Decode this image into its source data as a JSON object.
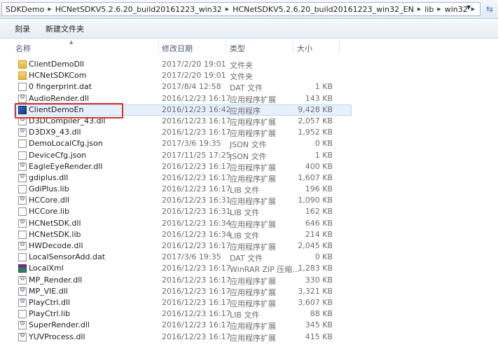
{
  "address_bar": {
    "crumbs": [
      "SDKDemo",
      "HCNetSDKV5.2.6.20_build20161223_win32",
      "HCNetSDKV5.2.6.20_build20161223_win32_EN",
      "lib",
      "win32"
    ]
  },
  "toolbar": {
    "burn_label": "刻录",
    "new_folder_label": "新建文件夹"
  },
  "columns": {
    "name": "名称",
    "modified": "修改日期",
    "type": "类型",
    "size": "大小"
  },
  "files": [
    {
      "name": "ClientDemoDll",
      "date": "2017/2/20 19:01",
      "type": "文件夹",
      "size": "",
      "icon": "folder-icon"
    },
    {
      "name": "HCNetSDKCom",
      "date": "2017/2/20 19:01",
      "type": "文件夹",
      "size": "",
      "icon": "folder-icon"
    },
    {
      "name": "0 fingerprint.dat",
      "date": "2017/8/4 12:58",
      "type": "DAT 文件",
      "size": "1 KB",
      "icon": "file-icon"
    },
    {
      "name": "AudioRender.dll",
      "date": "2016/12/23 16:17",
      "type": "应用程序扩展",
      "size": "143 KB",
      "icon": "dll-icon"
    },
    {
      "name": "ClientDemoEn",
      "date": "2016/12/23 16:42",
      "type": "应用程序",
      "size": "9,428 KB",
      "icon": "exe-icon"
    },
    {
      "name": "D3DCompiler_43.dll",
      "date": "2016/12/23 16:17",
      "type": "应用程序扩展",
      "size": "2,057 KB",
      "icon": "dll-icon"
    },
    {
      "name": "D3DX9_43.dll",
      "date": "2016/12/23 16:17",
      "type": "应用程序扩展",
      "size": "1,952 KB",
      "icon": "dll-icon"
    },
    {
      "name": "DemoLocalCfg.json",
      "date": "2017/3/6 19:35",
      "type": "JSON 文件",
      "size": "0 KB",
      "icon": "file-icon"
    },
    {
      "name": "DeviceCfg.json",
      "date": "2017/11/25 17:25",
      "type": "JSON 文件",
      "size": "1 KB",
      "icon": "file-icon"
    },
    {
      "name": "EagleEyeRender.dll",
      "date": "2016/12/23 16:17",
      "type": "应用程序扩展",
      "size": "400 KB",
      "icon": "dll-icon"
    },
    {
      "name": "gdiplus.dll",
      "date": "2016/12/23 16:17",
      "type": "应用程序扩展",
      "size": "1,607 KB",
      "icon": "dll-icon"
    },
    {
      "name": "GdiPlus.lib",
      "date": "2016/12/23 16:17",
      "type": "LIB 文件",
      "size": "196 KB",
      "icon": "file-icon"
    },
    {
      "name": "HCCore.dll",
      "date": "2016/12/23 16:31",
      "type": "应用程序扩展",
      "size": "1,090 KB",
      "icon": "dll-icon"
    },
    {
      "name": "HCCore.lib",
      "date": "2016/12/23 16:31",
      "type": "LIB 文件",
      "size": "162 KB",
      "icon": "file-icon"
    },
    {
      "name": "HCNetSDK.dll",
      "date": "2016/12/23 16:34",
      "type": "应用程序扩展",
      "size": "646 KB",
      "icon": "dll-icon"
    },
    {
      "name": "HCNetSDK.lib",
      "date": "2016/12/23 16:34",
      "type": "LIB 文件",
      "size": "214 KB",
      "icon": "file-icon"
    },
    {
      "name": "HWDecode.dll",
      "date": "2016/12/23 16:17",
      "type": "应用程序扩展",
      "size": "2,045 KB",
      "icon": "dll-icon"
    },
    {
      "name": "LocalSensorAdd.dat",
      "date": "2017/3/6 19:35",
      "type": "DAT 文件",
      "size": "0 KB",
      "icon": "file-icon"
    },
    {
      "name": "LocalXml",
      "date": "2016/12/23 16:17",
      "type": "WinRAR ZIP 压缩...",
      "size": "1,283 KB",
      "icon": "rar-icon"
    },
    {
      "name": "MP_Render.dll",
      "date": "2016/12/23 16:17",
      "type": "应用程序扩展",
      "size": "330 KB",
      "icon": "dll-icon"
    },
    {
      "name": "MP_VIE.dll",
      "date": "2016/12/23 16:17",
      "type": "应用程序扩展",
      "size": "3,321 KB",
      "icon": "dll-icon"
    },
    {
      "name": "PlayCtrl.dll",
      "date": "2016/12/23 16:17",
      "type": "应用程序扩展",
      "size": "3,607 KB",
      "icon": "dll-icon"
    },
    {
      "name": "PlayCtrl.lib",
      "date": "2016/12/23 16:17",
      "type": "LIB 文件",
      "size": "88 KB",
      "icon": "file-icon"
    },
    {
      "name": "SuperRender.dll",
      "date": "2016/12/23 16:17",
      "type": "应用程序扩展",
      "size": "345 KB",
      "icon": "dll-icon"
    },
    {
      "name": "YUVProcess.dll",
      "date": "2016/12/23 16:17",
      "type": "应用程序扩展",
      "size": "415 KB",
      "icon": "dll-icon"
    }
  ],
  "highlight_color": "#d9322f"
}
